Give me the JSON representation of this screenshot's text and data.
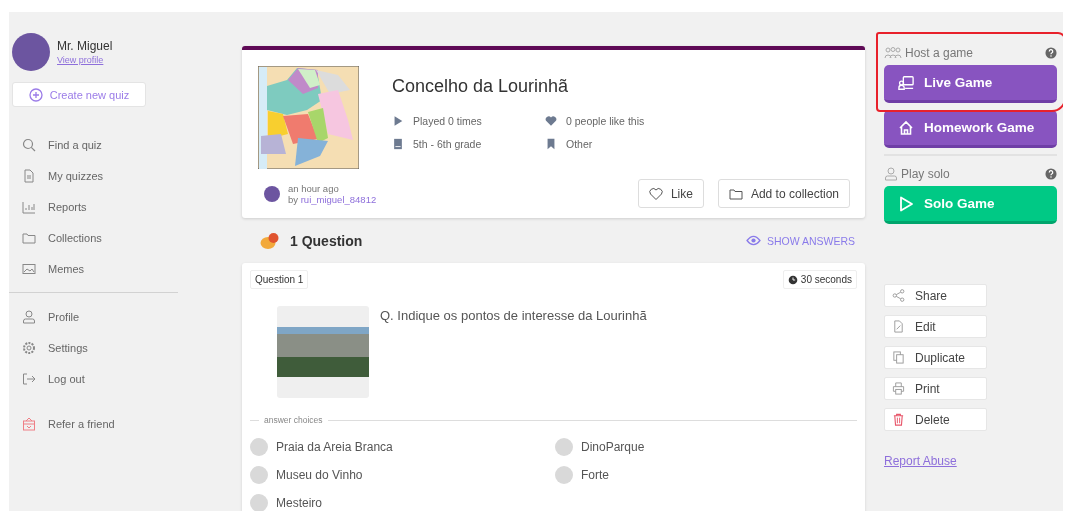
{
  "user": {
    "name": "Mr. Miguel",
    "view_profile": "View profile"
  },
  "create_button": "Create new quiz",
  "nav": [
    {
      "label": "Find a quiz"
    },
    {
      "label": "My quizzes"
    },
    {
      "label": "Reports"
    },
    {
      "label": "Collections"
    },
    {
      "label": "Memes"
    }
  ],
  "nav_secondary": [
    {
      "label": "Profile"
    },
    {
      "label": "Settings"
    },
    {
      "label": "Log out"
    }
  ],
  "refer": {
    "label": "Refer a friend"
  },
  "quiz": {
    "title": "Concelho da Lourinhã",
    "stats": [
      {
        "text": "Played 0 times"
      },
      {
        "text": "0 people like this"
      },
      {
        "text": "5th - 6th grade"
      },
      {
        "text": "Other"
      }
    ],
    "time": "an hour ago",
    "author_prefix": "by",
    "author": "rui_miguel_84812",
    "buttons": [
      {
        "label": "Like"
      },
      {
        "label": "Add to collection"
      }
    ]
  },
  "questions_header": {
    "count": "1 Question",
    "show_answers": "SHOW ANSWERS"
  },
  "question": {
    "number": "Question 1",
    "time": "30 seconds",
    "text": "Q. Indique os pontos de interesse da Lourinhã",
    "choices_label": "answer choices",
    "choices": [
      {
        "text": "Praia da Areia Branca",
        "selected": false
      },
      {
        "text": "DinoParque",
        "selected": false
      },
      {
        "text": "Museu do Vinho",
        "selected": false
      },
      {
        "text": "Forte",
        "selected": false
      },
      {
        "text": "Mesteiro",
        "selected": false
      }
    ]
  },
  "host": {
    "label": "Host a game",
    "buttons": [
      {
        "kind": "live",
        "label": "Live Game"
      },
      {
        "kind": "homework",
        "label": "Homework Game"
      }
    ]
  },
  "solo": {
    "label": "Play solo",
    "buttons": [
      {
        "kind": "solo",
        "label": "Solo Game"
      }
    ]
  },
  "actions": [
    {
      "label": "Share",
      "kind": "normal"
    },
    {
      "label": "Edit",
      "kind": "normal"
    },
    {
      "label": "Duplicate",
      "kind": "normal"
    },
    {
      "label": "Print",
      "kind": "normal"
    },
    {
      "label": "Delete",
      "kind": "danger"
    }
  ],
  "report": "Report Abuse"
}
